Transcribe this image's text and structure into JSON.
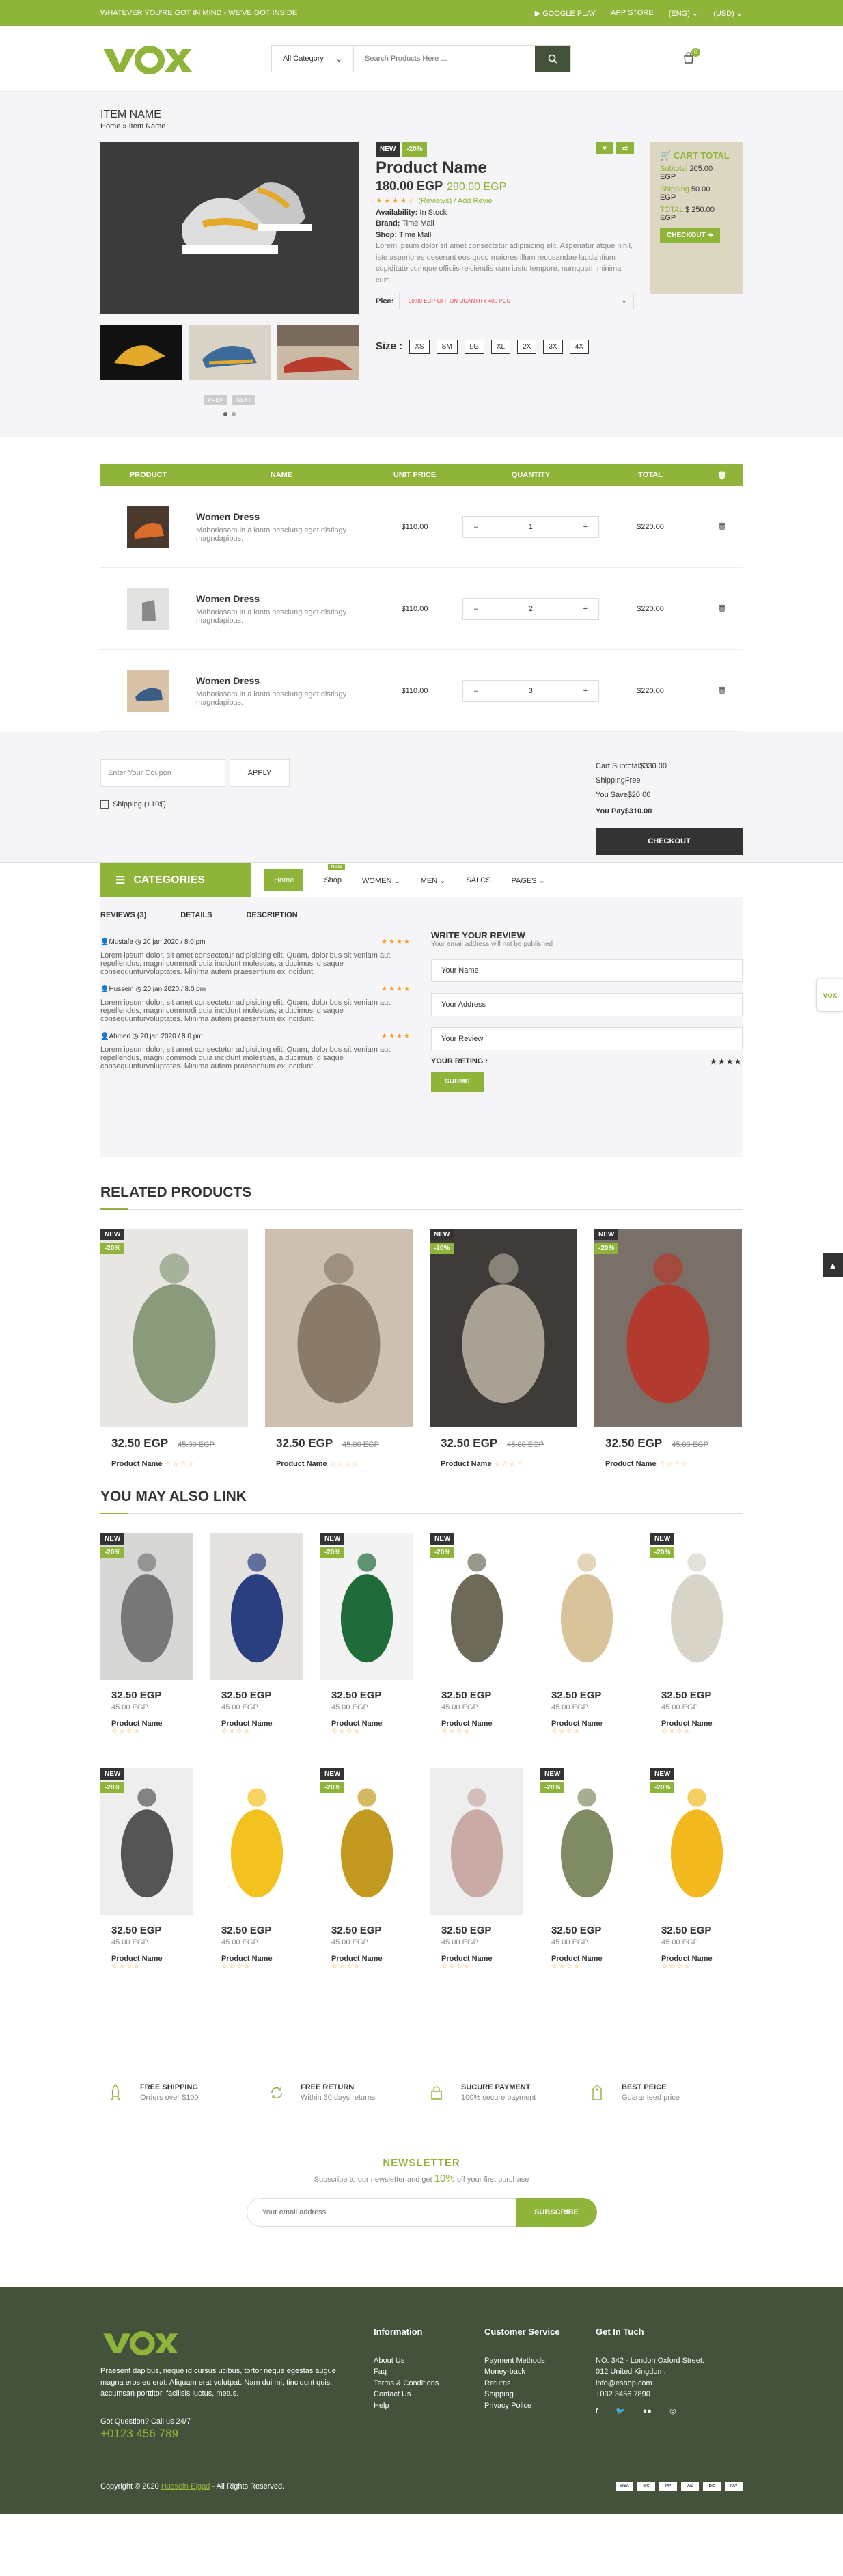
{
  "topbar": {
    "promo": "WHATEVER YOU'RE GOT IN MIND - WE'VE GOT INSIDE",
    "google_play": "GOOGLE PLAY",
    "app_store": "APP STORE",
    "language": "(ENG)",
    "currency": "(USD)"
  },
  "header": {
    "logo": "vox",
    "category": "All Category",
    "search_placeholder": "Search Products Here ...",
    "cart_count": "0"
  },
  "breadcrumb": {
    "title": "ITEM NAME",
    "home": "Home",
    "current": "Item Name"
  },
  "product": {
    "tag_new": "NEW",
    "tag_off": "-20%",
    "name": "Product Name",
    "price": "180.00 EGP",
    "old_price": "290.00 EGP",
    "stars": "★★★★☆",
    "reviews": "(Reviews)",
    "add_review": "Add Revie",
    "availability_label": "Availability:",
    "availability": "In Stock",
    "brand_label": "Brand:",
    "brand": "Time Mall",
    "shop_label": "Shop:",
    "shop": "Time Mall",
    "description": "Lorem ipsum dolor sit amet consectetur adipisicing elit. Asperiatur atque nihil, iste asperiores deserunt eos quod maiores illum recusandae laudantium cupiditate cumque officiis reiciendis cum iusto tempore, numquam minima cum.",
    "pice_label": "Pice:",
    "pice_option": "-90.00 EGP-OFF ON QUANTITY 400 PCS",
    "size_label": "Size :",
    "sizes": [
      "XS",
      "SM",
      "LG",
      "XL",
      "2X",
      "3X",
      "4X"
    ],
    "gallery_btns": [
      "PREV",
      "NEXT"
    ]
  },
  "cart_summary": {
    "title": "CART TOTAL",
    "subtotal_label": "Subtotal",
    "subtotal": "205.00",
    "currency": "EGP",
    "shipping_label": "Shipping",
    "shipping": "50.00",
    "total_label": "TOTAL",
    "total": "$ 250.00",
    "checkout": "CHECKOUT"
  },
  "cart": {
    "headers": [
      "PRODUCT",
      "NAME",
      "UNIT PRICE",
      "QUANTITY",
      "TOTAL"
    ],
    "rows": [
      {
        "name": "Women Dress",
        "desc": "Maboriosam in a lonto nesciung eget distingy magndapibus.",
        "price": "$110.00",
        "qty": "1",
        "total": "$220.00"
      },
      {
        "name": "Women Dress",
        "desc": "Maboriosam in a lonto nesciung eget distingy magndapibus.",
        "price": "$110.00",
        "qty": "2",
        "total": "$220.00"
      },
      {
        "name": "Women Dress",
        "desc": "Maboriosam in a lonto nesciung eget distingy magndapibus.",
        "price": "$110.00",
        "qty": "3",
        "total": "$220.00"
      }
    ],
    "coupon_placeholder": "Enter Your Coupon",
    "apply": "APPLY",
    "shipping_opt": "Shipping (+10$)",
    "subtotal": "Cart Subtotal$330.00",
    "shipping": "ShippingFree",
    "save": "You Save$20.00",
    "pay": "You Pay$310.00",
    "checkout": "CHECKOUT"
  },
  "nav": {
    "categories": "CATEGORIES",
    "home": "Home",
    "shop": "Shop",
    "shop_badge": "NEW",
    "women": "WOMEN",
    "men": "MEN",
    "sales": "SALCS",
    "pages": "PAGES"
  },
  "reviews": {
    "tabs": [
      "REVIEWS (3)",
      "DETAILS",
      "DESCRIPTION"
    ],
    "items": [
      {
        "author": "Mustafa",
        "date": "20 jan 2020 / 8.0 pm",
        "stars": "★★★★",
        "text": "Lorem ipsum dolor, sit amet consectetur adipisicing elit. Quam, doloribus sit veniam aut repellendus, magni commodi quia incidunt molestias, a ducimus id saque consequunturvoluptates. Minima autem praesentium ex incidunt."
      },
      {
        "author": "Hussein",
        "date": "20 jan 2020 / 8.0 pm",
        "stars": "★★★★",
        "text": "Lorem ipsum dolor, sit amet consectetur adipisicing elit. Quam, doloribus sit veniam aut repellendus, magni commodi quia incidunt molestias, a ducimus id saque consequunturvoluptates. Minima autem praesentium ex incidunt."
      },
      {
        "author": "Ahmed",
        "date": "20 jan 2020 / 8.0 pm",
        "stars": "★★★★",
        "text": "Lorem ipsum dolor, sit amet consectetur adipisicing elit. Quam, doloribus sit veniam aut repellendus, magni commodi quia incidunt molestias, a ducimus id saque consequunturvoluptates. Minima autem praesentium ex incidunt."
      }
    ],
    "write_title": "WRITE YOUR REVIEW",
    "write_sub": "Your email address will not be published",
    "name": "Your Name",
    "address": "Your Address",
    "review": "Your Review",
    "rating_label": "YOUR RETING :",
    "rating_stars": "★★★★",
    "submit": "SUBMIT"
  },
  "related": {
    "title": "RELATED PRODUCTS",
    "items": [
      {
        "new": "NEW",
        "off": "-20%",
        "price": "32.50 EGP",
        "old": "45.00 EGP",
        "name": "Product Name",
        "stars": "☆☆☆☆"
      },
      {
        "new": "",
        "off": "",
        "price": "32.50 EGP",
        "old": "45.00 EGP",
        "name": "Product Name",
        "stars": "☆☆☆☆"
      },
      {
        "new": "NEW",
        "off": "-20%",
        "price": "32.50 EGP",
        "old": "45.00 EGP",
        "name": "Product Name",
        "stars": "☆☆☆☆"
      },
      {
        "new": "NEW",
        "off": "-20%",
        "price": "32.50 EGP",
        "old": "45.00 EGP",
        "name": "Product Name",
        "stars": "☆☆☆☆"
      }
    ]
  },
  "also": {
    "title": "YOU MAY ALSO LINK",
    "items": [
      {
        "new": "NEW",
        "off": "-20%",
        "price": "32.50 EGP",
        "old": "45.00 EGP",
        "name": "Product Name",
        "stars": "☆☆☆☆"
      },
      {
        "new": "",
        "off": "",
        "price": "32.50 EGP",
        "old": "45.00 EGP",
        "name": "Product Name",
        "stars": "☆☆☆☆"
      },
      {
        "new": "NEW",
        "off": "-20%",
        "price": "32.50 EGP",
        "old": "45.00 EGP",
        "name": "Product Name",
        "stars": "☆☆☆☆"
      },
      {
        "new": "NEW",
        "off": "-20%",
        "price": "32.50 EGP",
        "old": "45.00 EGP",
        "name": "Product Name",
        "stars": "☆☆☆☆"
      },
      {
        "new": "",
        "off": "",
        "price": "32.50 EGP",
        "old": "45.00 EGP",
        "name": "Product Name",
        "stars": "☆☆☆☆"
      },
      {
        "new": "NEW",
        "off": "-20%",
        "price": "32.50 EGP",
        "old": "45.00 EGP",
        "name": "Product Name",
        "stars": "☆☆☆☆"
      },
      {
        "new": "NEW",
        "off": "-20%",
        "price": "32.50 EGP",
        "old": "45.00 EGP",
        "name": "Product Name",
        "stars": "☆☆☆☆"
      },
      {
        "new": "",
        "off": "",
        "price": "32.50 EGP",
        "old": "45.00 EGP",
        "name": "Product Name",
        "stars": "☆☆☆☆"
      },
      {
        "new": "NEW",
        "off": "-20%",
        "price": "32.50 EGP",
        "old": "45.00 EGP",
        "name": "Product Name",
        "stars": "☆☆☆☆"
      },
      {
        "new": "",
        "off": "",
        "price": "32.50 EGP",
        "old": "45.00 EGP",
        "name": "Product Name",
        "stars": "☆☆☆☆"
      },
      {
        "new": "NEW",
        "off": "-20%",
        "price": "32.50 EGP",
        "old": "45.00 EGP",
        "name": "Product Name",
        "stars": "☆☆☆☆"
      },
      {
        "new": "NEW",
        "off": "-20%",
        "price": "32.50 EGP",
        "old": "45.00 EGP",
        "name": "Product Name",
        "stars": "☆☆☆☆"
      }
    ]
  },
  "features": [
    {
      "title": "FREE SHIPPING",
      "sub": "Orders over $100"
    },
    {
      "title": "FREE RETURN",
      "sub": "Within 30 days returns"
    },
    {
      "title": "SUCURE PAYMENT",
      "sub": "100% secure payment"
    },
    {
      "title": "BEST PEICE",
      "sub": "Guaranteed price"
    }
  ],
  "newsletter": {
    "title": "NEWSLETTER",
    "sub_a": "Subscribe to our newsletter and get",
    "sub_pct": "10%",
    "sub_b": "off your first purchase",
    "placeholder": "Your email address",
    "button": "SUBSCRIBE"
  },
  "footer": {
    "about": "Praesent dapibus, neque id cursus ucibus, tortor neque egestas augue, magna eros eu erat. Aliquam erat volutpat. Nam dui mi, tincidunt quis, accumsan porttitor, facilisis luctus, metus.",
    "question": "Got Question? Call us 24/7",
    "phone": "+0123 456 789",
    "info_title": "Information",
    "info": [
      "About Us",
      "Faq",
      "Terms & Conditions",
      "Contact Us",
      "Help"
    ],
    "cs_title": "Customer Service",
    "cs": [
      "Payment Methods",
      "Money-back",
      "Returns",
      "Shipping",
      "Privacy Police"
    ],
    "touch_title": "Get In Tuch",
    "touch": [
      "NO. 342 - London Oxford Street.",
      "012 United Kingdom.",
      "info@eshop.com",
      "+032 3456 7890"
    ],
    "copy_a": "Copyright © 2020",
    "copy_link": "Hussein-Elgad",
    "copy_b": "- All Rights Reserved.",
    "payments": [
      "VISA",
      "MC",
      "PP",
      "AE",
      "DC",
      "PAY"
    ]
  },
  "colors": {
    "accent": "#8fb43a",
    "dark": "#44513b"
  }
}
